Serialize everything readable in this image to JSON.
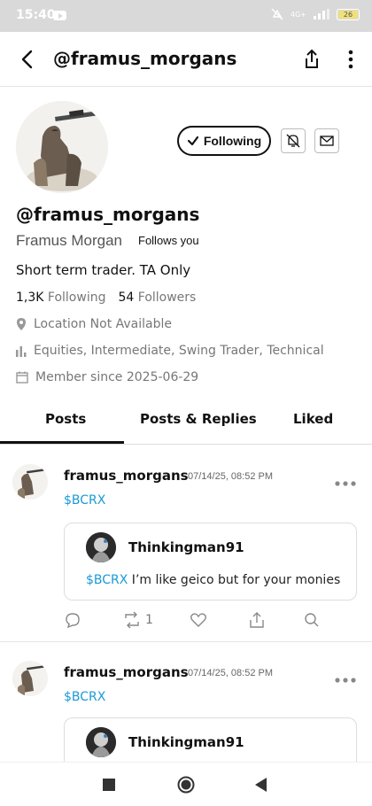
{
  "status_bar": {
    "time": "15:40",
    "network": "4G+",
    "battery": "26"
  },
  "header": {
    "title": "@framus_morgans"
  },
  "profile": {
    "following_label": "Following",
    "handle": "@framus_morgans",
    "display_name": "Framus Morgan",
    "follows_you": "Follows you",
    "bio": "Short term trader. TA Only",
    "following_count": "1,3K",
    "following_label_text": "Following",
    "followers_count": "54",
    "followers_label_text": "Followers",
    "location": "Location Not Available",
    "interests": "Equities, Intermediate, Swing Trader, Technical",
    "member_since": "Member since 2025-06-29"
  },
  "tabs": [
    {
      "label": "Posts",
      "active": true
    },
    {
      "label": "Posts & Replies",
      "active": false
    },
    {
      "label": "Liked",
      "active": false
    }
  ],
  "posts": [
    {
      "user": "framus_morgans",
      "time": "07/14/25, 08:52 PM",
      "ticker": "$BCRX",
      "quote": {
        "user": "Thinkingman91",
        "ticker": "$BCRX",
        "text": " I’m like geico but for your monies"
      },
      "reposts": "1"
    },
    {
      "user": "framus_morgans",
      "time": "07/14/25, 08:52 PM",
      "ticker": "$BCRX",
      "quote": {
        "user": "Thinkingman91"
      }
    }
  ],
  "colors": {
    "ticker": "#1a9ad6",
    "status_bar": "#d9d9d9",
    "muted": "#777777"
  },
  "icons": [
    "back-arrow-icon",
    "share-icon",
    "more-vertical-icon",
    "bell-off-icon",
    "mail-icon",
    "location-pin-icon",
    "bar-chart-icon",
    "calendar-icon",
    "comment-icon",
    "repost-icon",
    "heart-icon",
    "share-post-icon",
    "search-icon"
  ]
}
